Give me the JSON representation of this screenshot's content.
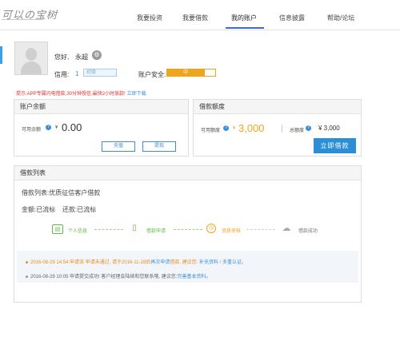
{
  "header": {
    "logo": "可以の宝树",
    "nav": [
      "我要投资",
      "我要借款",
      "我的账户",
      "信息披露",
      "帮助/论坛"
    ],
    "active_index": 2
  },
  "profile": {
    "greeting": "您好,",
    "user_name": "永超",
    "credit_label": "信用:",
    "credit_value": "1",
    "credit_box_text": "初级",
    "security_label": "账户安全:",
    "security_level": "中"
  },
  "notice": {
    "text": "提示:APP专属闪电借款,30分钟授信,最快2小时放款!",
    "link": "立即下载"
  },
  "balance": {
    "title": "账户余额",
    "label": "可用余额",
    "currency": "¥",
    "value": "0.00",
    "recharge": "充值",
    "withdraw": "提现"
  },
  "quota": {
    "title": "借款额度",
    "available_label": "可用额度",
    "available_currency": "¥",
    "available_value": "3,000",
    "total_label": "总额度",
    "total_value": "¥ 3,000",
    "borrow_button": "立即借款"
  },
  "loan": {
    "title": "借款列表",
    "list_label": "借款列表:优质征信客户借款",
    "amount_label": "金额:已流标",
    "repay_label": "还款:已流标",
    "steps": [
      {
        "label": "个人信息",
        "icon": "id-card-icon",
        "state": "done"
      },
      {
        "label": "借款申请",
        "icon": "document-icon",
        "state": "done"
      },
      {
        "label": "资质审核",
        "icon": "clock-icon",
        "state": "current"
      },
      {
        "label": "借款成功",
        "icon": "piggy-bank-icon",
        "state": "pending"
      }
    ],
    "logs": [
      {
        "text": "2016-08-29 14:54 申请流  申请未通过, 请于2016-11-28后",
        "link1": "再次申请",
        "mid": "借款, 建议您:",
        "link2": "补充资料",
        "sep": "/",
        "link3": "多重认证",
        "end": "。"
      },
      {
        "text": "2016-08-29 10:05 申请提交成功! 客户经理会陆续和您联系哦, 建议您:",
        "link1": "完善基本资料",
        "end": "。"
      }
    ]
  },
  "colors": {
    "accent_blue": "#2c8fd6",
    "warning_orange": "#f0a51f",
    "success_green": "#5fb84a",
    "alert_red": "#e0302a"
  }
}
